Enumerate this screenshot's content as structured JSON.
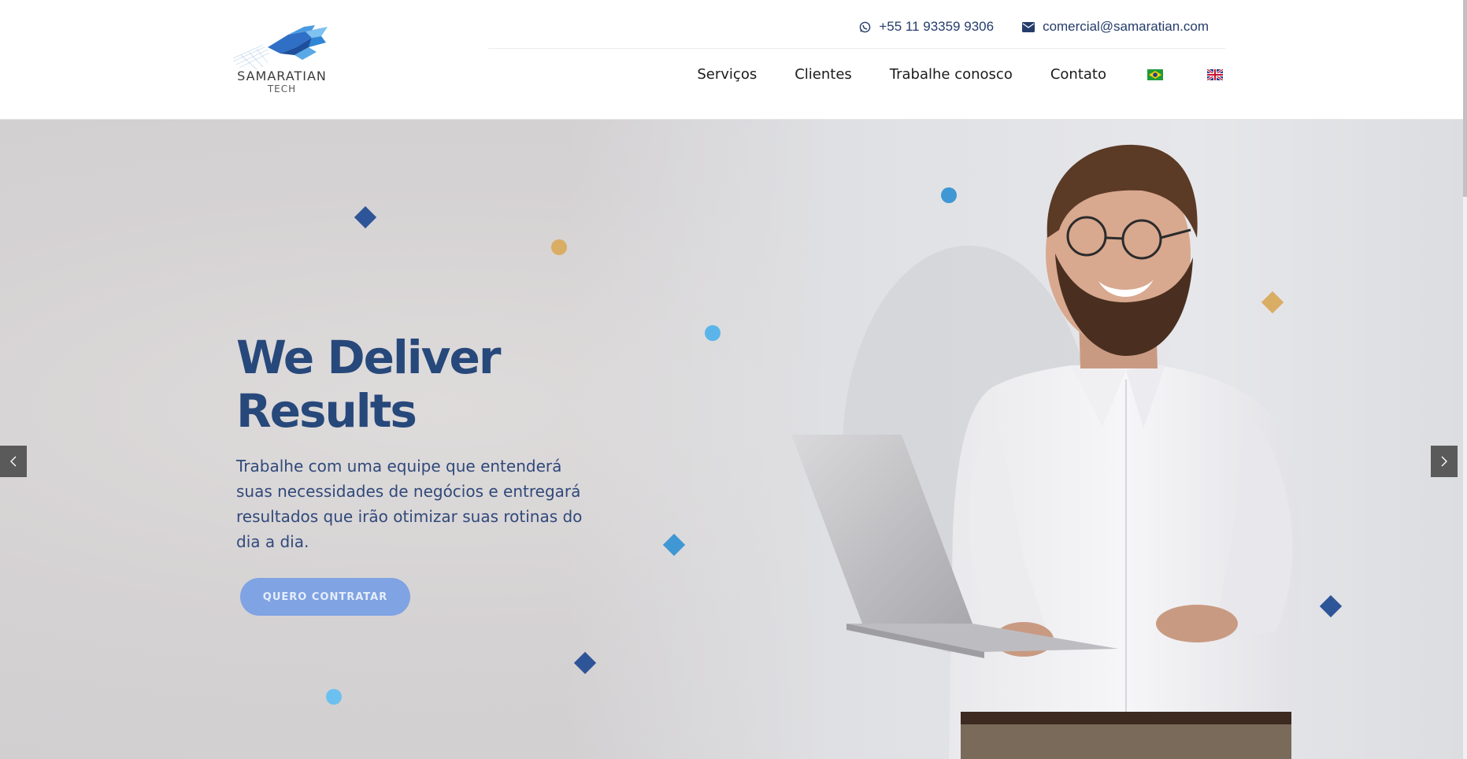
{
  "brand": {
    "name": "SAMARATIAN",
    "sub": "TECH"
  },
  "contact": {
    "phone": "+55 11 93359 9306",
    "email": "comercial@samaratian.com"
  },
  "nav": {
    "items": [
      "Serviços",
      "Clientes",
      "Trabalhe conosco",
      "Contato"
    ],
    "languages": [
      "pt-br-flag-icon",
      "en-gb-flag-icon"
    ]
  },
  "hero": {
    "title": "We Deliver Results",
    "text": "Trabalhe com uma equipe que entenderá suas necessidades de negócios e entregará resultados que irão otimizar suas rotinas do dia a dia.",
    "cta": "QUERO CONTRATAR"
  },
  "colors": {
    "primary": "#27487a",
    "accent_blue": "#3f9bd8",
    "accent_gold": "#d9ad64",
    "button": "#7fa3e3"
  }
}
